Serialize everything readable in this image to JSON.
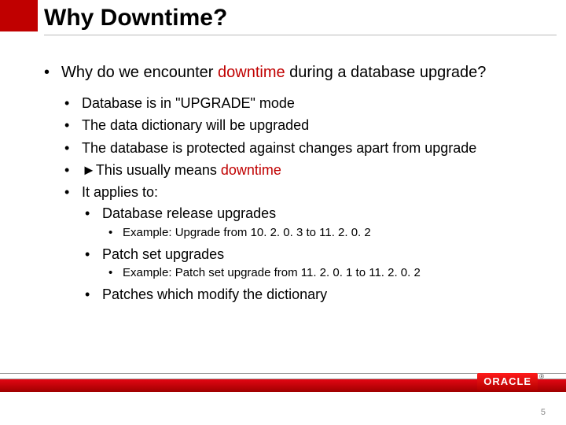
{
  "title": "Why Downtime?",
  "lead": {
    "pre": "Why do we encounter ",
    "hl": "downtime",
    "post": " during a database upgrade?"
  },
  "points": {
    "p1": "Database is in \"UPGRADE\" mode",
    "p2": "The data dictionary will be upgraded",
    "p3": "The database is protected against changes apart from upgrade",
    "p4_pre": "►This usually means ",
    "p4_hl": "downtime",
    "p5": "It applies to:",
    "sub1": "Database release upgrades",
    "sub1_ex": "Example: Upgrade from 10. 2. 0. 3 to 11. 2. 0. 2",
    "sub2": "Patch set upgrades",
    "sub2_ex": "Example: Patch set upgrade from 11. 2. 0. 1 to 11. 2. 0. 2",
    "sub3": "Patches which modify the dictionary"
  },
  "logo": "ORACLE",
  "page": "5"
}
